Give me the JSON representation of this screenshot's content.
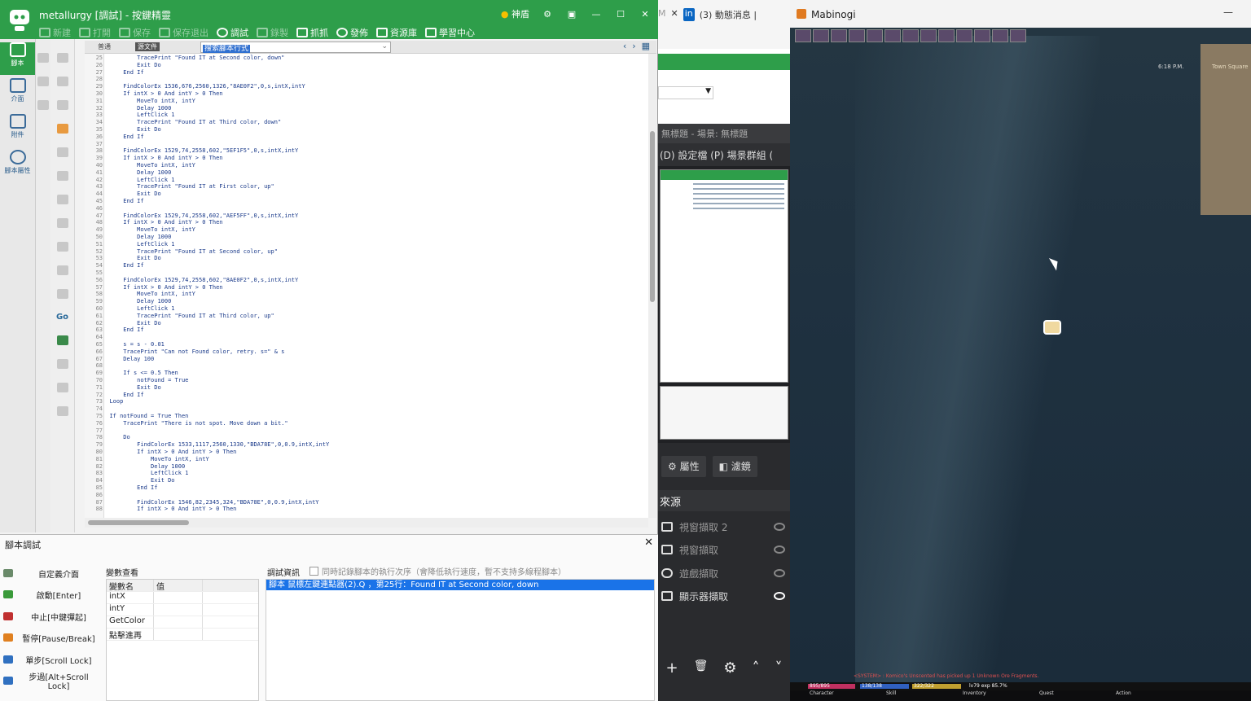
{
  "editor": {
    "title": "metallurgy [調試] - 按鍵精靈",
    "status_label": "神盾",
    "window_controls": [
      "⚙",
      "▣",
      "—",
      "☐",
      "✕"
    ],
    "toolbar": [
      {
        "label": "新建",
        "icon": "new-icon",
        "enabled": false
      },
      {
        "label": "打開",
        "icon": "open-icon",
        "enabled": false
      },
      {
        "label": "保存",
        "icon": "save-icon",
        "enabled": false
      },
      {
        "label": "保存退出",
        "icon": "save-exit-icon",
        "enabled": false
      },
      {
        "label": "調試",
        "icon": "debug-icon",
        "enabled": true
      },
      {
        "label": "錄製",
        "icon": "record-icon",
        "enabled": false
      },
      {
        "label": "抓抓",
        "icon": "capture-icon",
        "enabled": true
      },
      {
        "label": "發佈",
        "icon": "publish-icon",
        "enabled": true
      },
      {
        "label": "資源庫",
        "icon": "library-icon",
        "enabled": true
      },
      {
        "label": "學習中心",
        "icon": "learn-icon",
        "enabled": true
      }
    ],
    "nav": [
      {
        "label": "腳本",
        "icon": "script-icon",
        "active": true
      },
      {
        "label": "介面",
        "icon": "ui-icon",
        "active": false
      },
      {
        "label": "附件",
        "icon": "attachment-icon",
        "active": false
      },
      {
        "label": "腳本屬性",
        "icon": "info-icon",
        "active": false
      }
    ],
    "tabs": {
      "normal": "普通",
      "source": "源文件",
      "search_text": "搜索腳本行式"
    },
    "code_lines": [
      {
        "n": "25",
        "t": "        TracePrint \"Found IT at Second color, down\""
      },
      {
        "n": "26",
        "t": "        Exit Do"
      },
      {
        "n": "27",
        "t": "    End If"
      },
      {
        "n": "28",
        "t": ""
      },
      {
        "n": "29",
        "t": "    FindColorEx 1536,676,2560,1326,\"8AE0F2\",0,s,intX,intY"
      },
      {
        "n": "30",
        "t": "    If intX > 0 And intY > 0 Then"
      },
      {
        "n": "31",
        "t": "        MoveTo intX, intY"
      },
      {
        "n": "32",
        "t": "        Delay 1000"
      },
      {
        "n": "33",
        "t": "        LeftClick 1"
      },
      {
        "n": "34",
        "t": "        TracePrint \"Found IT at Third color, down\""
      },
      {
        "n": "35",
        "t": "        Exit Do"
      },
      {
        "n": "36",
        "t": "    End If"
      },
      {
        "n": "37",
        "t": ""
      },
      {
        "n": "38",
        "t": "    FindColorEx 1529,74,2558,602,\"5EF1F5\",0,s,intX,intY"
      },
      {
        "n": "39",
        "t": "    If intX > 0 And intY > 0 Then"
      },
      {
        "n": "40",
        "t": "        MoveTo intX, intY"
      },
      {
        "n": "41",
        "t": "        Delay 1000"
      },
      {
        "n": "42",
        "t": "        LeftClick 1"
      },
      {
        "n": "43",
        "t": "        TracePrint \"Found IT at First color, up\""
      },
      {
        "n": "44",
        "t": "        Exit Do"
      },
      {
        "n": "45",
        "t": "    End If"
      },
      {
        "n": "46",
        "t": ""
      },
      {
        "n": "47",
        "t": "    FindColorEx 1529,74,2558,602,\"AEF5FF\",0,s,intX,intY"
      },
      {
        "n": "48",
        "t": "    If intX > 0 And intY > 0 Then"
      },
      {
        "n": "49",
        "t": "        MoveTo intX, intY"
      },
      {
        "n": "50",
        "t": "        Delay 1000"
      },
      {
        "n": "51",
        "t": "        LeftClick 1"
      },
      {
        "n": "52",
        "t": "        TracePrint \"Found IT at Second color, up\""
      },
      {
        "n": "53",
        "t": "        Exit Do"
      },
      {
        "n": "54",
        "t": "    End If"
      },
      {
        "n": "55",
        "t": ""
      },
      {
        "n": "56",
        "t": "    FindColorEx 1529,74,2558,602,\"8AE0F2\",0,s,intX,intY"
      },
      {
        "n": "57",
        "t": "    If intX > 0 And intY > 0 Then"
      },
      {
        "n": "58",
        "t": "        MoveTo intX, intY"
      },
      {
        "n": "59",
        "t": "        Delay 1000"
      },
      {
        "n": "60",
        "t": "        LeftClick 1"
      },
      {
        "n": "61",
        "t": "        TracePrint \"Found IT at Third color, up\""
      },
      {
        "n": "62",
        "t": "        Exit Do"
      },
      {
        "n": "63",
        "t": "    End If"
      },
      {
        "n": "64",
        "t": ""
      },
      {
        "n": "65",
        "t": "    s = s - 0.01"
      },
      {
        "n": "66",
        "t": "    TracePrint \"Can not Found color, retry. s=\" & s"
      },
      {
        "n": "67",
        "t": "    Delay 100"
      },
      {
        "n": "68",
        "t": ""
      },
      {
        "n": "69",
        "t": "    If s <= 0.5 Then"
      },
      {
        "n": "70",
        "t": "        notFound = True"
      },
      {
        "n": "71",
        "t": "        Exit Do"
      },
      {
        "n": "72",
        "t": "    End If"
      },
      {
        "n": "73",
        "t": "Loop"
      },
      {
        "n": "74",
        "t": ""
      },
      {
        "n": "75",
        "t": "If notFound = True Then"
      },
      {
        "n": "76",
        "t": "    TracePrint \"There is not spot. Move down a bit.\""
      },
      {
        "n": "77",
        "t": ""
      },
      {
        "n": "78",
        "t": "    Do"
      },
      {
        "n": "79",
        "t": "        FindColorEx 1533,1117,2560,1330,\"BDA78E\",0,0.9,intX,intY"
      },
      {
        "n": "80",
        "t": "        If intX > 0 And intY > 0 Then"
      },
      {
        "n": "81",
        "t": "            MoveTo intX, intY"
      },
      {
        "n": "82",
        "t": "            Delay 1000"
      },
      {
        "n": "83",
        "t": "            LeftClick 1"
      },
      {
        "n": "84",
        "t": "            Exit Do"
      },
      {
        "n": "85",
        "t": "        End If"
      },
      {
        "n": "86",
        "t": ""
      },
      {
        "n": "87",
        "t": "        FindColorEx 1546,82,2345,324,\"BDA78E\",0,0.9,intX,intY"
      },
      {
        "n": "88",
        "t": "        If intX > 0 And intY > 0 Then"
      }
    ],
    "debug": {
      "title": "腳本調試",
      "buttons": [
        {
          "label": "自定義介面",
          "color": "#6a8a6a"
        },
        {
          "label": "啟動[Enter]",
          "color": "#3a9a3a"
        },
        {
          "label": "中止[中鍵彈起]",
          "color": "#c03030"
        },
        {
          "label": "暫停[Pause/Break]",
          "color": "#e08020"
        },
        {
          "label": "單步[Scroll Lock]",
          "color": "#3070c0"
        },
        {
          "label": "步過[Alt+Scroll Lock]",
          "color": "#3070c0"
        }
      ],
      "var_title": "變數查看",
      "var_headers": [
        "變數名",
        "值"
      ],
      "vars": [
        "intX",
        "intY",
        "GetColor",
        "點擊進再"
      ],
      "info_title": "調試資訊",
      "option_label": "同時記錄腳本的執行次序（會降低執行速度，暫不支持多線程腳本）",
      "log": "腳本 鼠標左鍵連點器(2).Q ，第25行：Found IT at Second color, down"
    }
  },
  "middle": {
    "browser_tabs": [
      "M",
      "✕",
      "in",
      "(3) 動態消息 |"
    ],
    "scene_title": "無標題 - 場景: 無標題",
    "menu": "(D)  設定檔 (P)   場景群組 (",
    "tabs": [
      "屬性",
      "濾鏡"
    ],
    "sources_header": "來源",
    "sources": [
      {
        "label": "視窗擷取 2",
        "visible": false
      },
      {
        "label": "視窗擷取",
        "visible": false
      },
      {
        "label": "遊戲擷取",
        "visible": false
      },
      {
        "label": "顯示器擷取",
        "visible": true
      }
    ],
    "bottom_buttons": [
      "+",
      "🗑",
      "⚙",
      "˄",
      "˅"
    ]
  },
  "game": {
    "title": "Mabinogi",
    "minimize": "—",
    "time": "6:18 P.M.",
    "map_label": "Town Square",
    "system_message": "<SYSTEM> : Komico's Unscented has picked up 1 Unknown Ore Fragments.",
    "hp": "895/895",
    "mp": "138/138",
    "sp": "322/322",
    "level": "lv79 exp 85.7%",
    "menu": [
      "Character",
      "Skill",
      "Inventory",
      "Quest",
      "Action"
    ]
  }
}
